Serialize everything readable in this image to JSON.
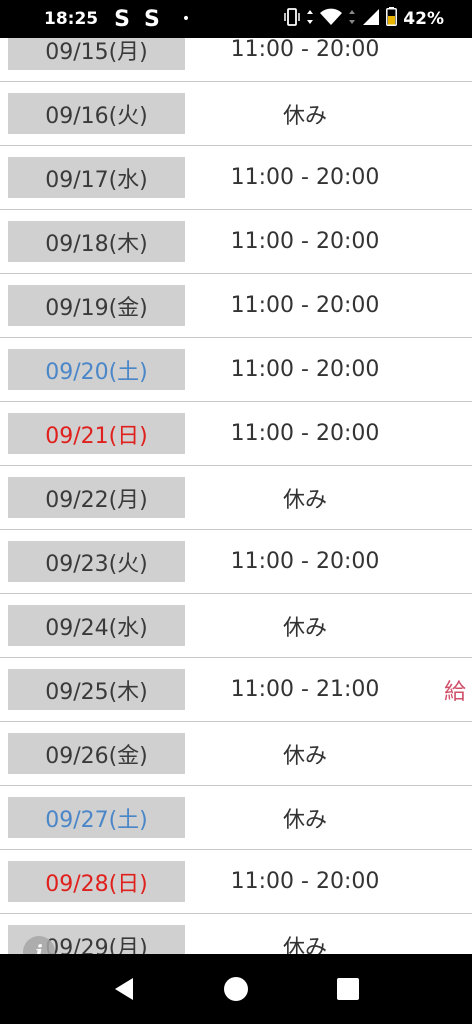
{
  "status_bar": {
    "time": "18:25",
    "notification_1": "S",
    "notification_2": "S",
    "dot": "•",
    "battery_percent": "42%"
  },
  "schedule": [
    {
      "date": "09/15(月)",
      "hours": "11:00 - 20:00",
      "day_type": "weekday",
      "extra": ""
    },
    {
      "date": "09/16(火)",
      "hours": "休み",
      "day_type": "weekday",
      "extra": ""
    },
    {
      "date": "09/17(水)",
      "hours": "11:00 - 20:00",
      "day_type": "weekday",
      "extra": ""
    },
    {
      "date": "09/18(木)",
      "hours": "11:00 - 20:00",
      "day_type": "weekday",
      "extra": ""
    },
    {
      "date": "09/19(金)",
      "hours": "11:00 - 20:00",
      "day_type": "weekday",
      "extra": ""
    },
    {
      "date": "09/20(土)",
      "hours": "11:00 - 20:00",
      "day_type": "saturday",
      "extra": ""
    },
    {
      "date": "09/21(日)",
      "hours": "11:00 - 20:00",
      "day_type": "sunday",
      "extra": ""
    },
    {
      "date": "09/22(月)",
      "hours": "休み",
      "day_type": "weekday",
      "extra": ""
    },
    {
      "date": "09/23(火)",
      "hours": "11:00 - 20:00",
      "day_type": "weekday",
      "extra": ""
    },
    {
      "date": "09/24(水)",
      "hours": "休み",
      "day_type": "weekday",
      "extra": ""
    },
    {
      "date": "09/25(木)",
      "hours": "11:00 - 21:00",
      "day_type": "weekday",
      "extra": "給"
    },
    {
      "date": "09/26(金)",
      "hours": "休み",
      "day_type": "weekday",
      "extra": ""
    },
    {
      "date": "09/27(土)",
      "hours": "休み",
      "day_type": "saturday",
      "extra": ""
    },
    {
      "date": "09/28(日)",
      "hours": "11:00 - 20:00",
      "day_type": "sunday",
      "extra": ""
    },
    {
      "date": "09/29(月)",
      "hours": "休み",
      "day_type": "weekday",
      "extra": ""
    }
  ],
  "info_button": {
    "icon": "info-icon",
    "glyph": "i"
  },
  "nav_bar": {
    "back": "back-icon",
    "home": "home-icon",
    "recents": "recents-icon"
  },
  "colors": {
    "saturday": "#4a86c8",
    "sunday": "#e0201c",
    "extra": "#d0506a",
    "date_cell_bg": "#d0d0d0"
  }
}
